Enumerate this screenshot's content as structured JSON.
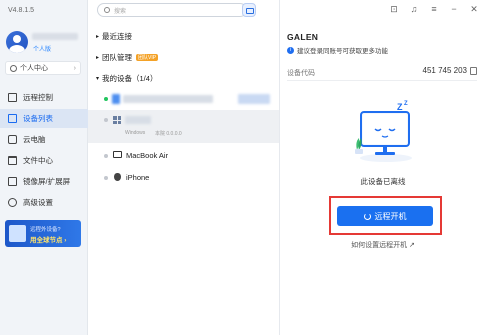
{
  "app": {
    "version": "V4.8.1.5"
  },
  "user": {
    "badge": "个人版",
    "personal_center": "个人中心"
  },
  "sidebar": {
    "items": [
      {
        "label": "远程控制",
        "icon": "monitor-icon",
        "active": false
      },
      {
        "label": "设备列表",
        "icon": "device-list-icon",
        "active": true
      },
      {
        "label": "云电脑",
        "icon": "cloud-pc-icon",
        "active": false
      },
      {
        "label": "文件中心",
        "icon": "folder-icon",
        "active": false
      },
      {
        "label": "镜像屏/扩展屏",
        "icon": "mirror-screen-icon",
        "active": false
      },
      {
        "label": "高级设置",
        "icon": "gear-icon",
        "active": false
      }
    ],
    "promo": {
      "line1": "远程外设备?",
      "line2": "用全球节点 ›"
    }
  },
  "search": {
    "placeholder": "搜索"
  },
  "groups": {
    "recent": "最近连接",
    "team": "团队管理",
    "team_badge": "团队VIP",
    "mine": "我的设备（1/4）"
  },
  "devices": [
    {
      "name": "",
      "status": "online"
    },
    {
      "name": "",
      "os": "Windows",
      "meta": "本院 0.0.0.0",
      "status": "offline",
      "selected": true
    },
    {
      "name": "MacBook Air",
      "status": "offline"
    },
    {
      "name": "iPhone",
      "status": "offline"
    }
  ],
  "detail": {
    "name": "GALEN",
    "warning": "建议登录同账号可获取更多功能",
    "code_label": "设备代码",
    "code_value": "451 745 203",
    "offline_text": "此设备已离线",
    "boot_button": "远程开机",
    "howto_link": "如何设置远程开机 ↗"
  },
  "colors": {
    "accent": "#1a70f0",
    "highlight": "#e53935",
    "online": "#22c55e"
  }
}
